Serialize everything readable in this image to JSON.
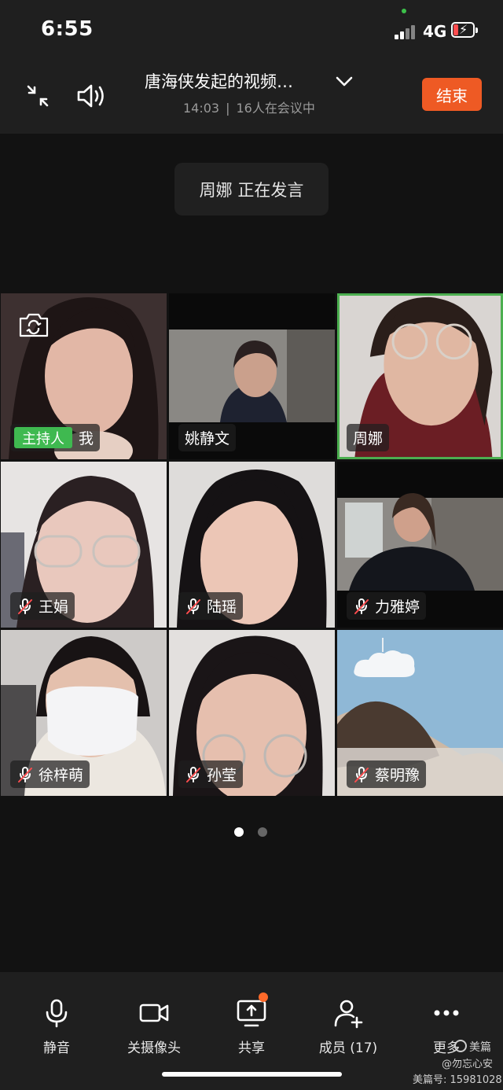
{
  "status_bar": {
    "time": "6:55",
    "network": "4G"
  },
  "header": {
    "title": "唐海侠发起的视频…",
    "time": "14:03",
    "separator": "|",
    "count": "16人在会议中",
    "end_label": "结束"
  },
  "speaking": "周娜  正在发言",
  "participants": [
    {
      "name": "我",
      "host_tag": "主持人",
      "muted": false
    },
    {
      "name": "姚静文",
      "muted": false
    },
    {
      "name": "周娜",
      "muted": false,
      "active": true
    },
    {
      "name": "王娟",
      "muted": true
    },
    {
      "name": "陆瑶",
      "muted": true
    },
    {
      "name": "力雅婷",
      "muted": true
    },
    {
      "name": "徐梓萌",
      "muted": true
    },
    {
      "name": "孙莹",
      "muted": true
    },
    {
      "name": "蔡明豫",
      "muted": true
    }
  ],
  "pagination": {
    "total": 2,
    "current": 1
  },
  "toolbar": {
    "mute": "静音",
    "camera_off": "关摄像头",
    "share": "共享",
    "members": "成员 (17)",
    "more": "更多"
  },
  "watermark": {
    "brand": "美篇",
    "author": "@勿忘心安",
    "id": "美篇号: 15981028"
  },
  "colors": {
    "end_button": "#ee5a24",
    "host_tag": "#3fb950",
    "active_border": "#4caf50",
    "background": "#121212"
  }
}
